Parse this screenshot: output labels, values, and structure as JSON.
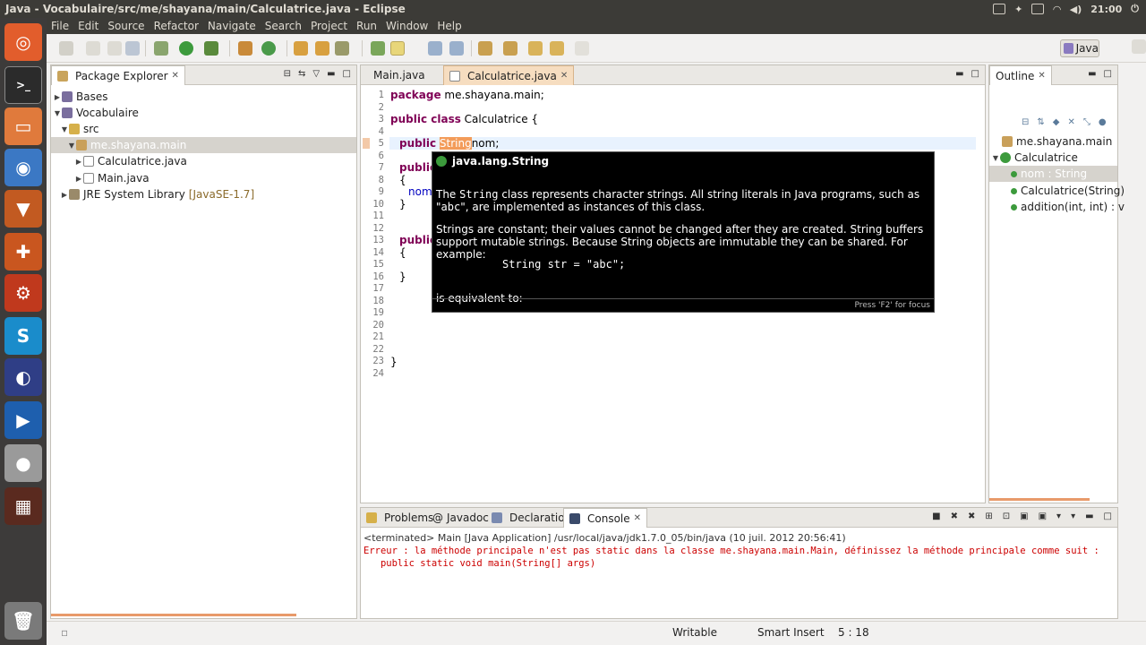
{
  "window": {
    "title": "Java - Vocabulaire/src/me/shayana/main/Calculatrice.java - Eclipse",
    "clock": "21:00"
  },
  "menu": [
    "File",
    "Edit",
    "Source",
    "Refactor",
    "Navigate",
    "Search",
    "Project",
    "Run",
    "Window",
    "Help"
  ],
  "toolbar": {
    "perspective_label": "Java"
  },
  "package_explorer": {
    "title": "Package Explorer",
    "items": [
      {
        "label": "Bases"
      },
      {
        "label": "Vocabulaire"
      },
      {
        "label": "src"
      },
      {
        "label": "me.shayana.main"
      },
      {
        "label": "Calculatrice.java"
      },
      {
        "label": "Main.java"
      },
      {
        "label": "JRE System Library",
        "suffix": "[JavaSE-1.7]"
      }
    ]
  },
  "editor": {
    "tabs": [
      "Main.java",
      "Calculatrice.java"
    ],
    "line_numbers": [
      "1",
      "2",
      "3",
      "4",
      "5",
      "6",
      "7",
      "8",
      "9",
      "10",
      "11",
      "12",
      "13",
      "14",
      "15",
      "16",
      "17",
      "18",
      "19",
      "20",
      "21",
      "22",
      "23",
      "24"
    ],
    "lines": {
      "l1_kw": "package",
      "l1_rest": " me.shayana.main;",
      "l3_kw": "public class",
      "l3_rest": " Calculatrice {",
      "l5_kw": "public",
      "l5_sel": "String",
      "l5_rest": "nom;",
      "l7": "public",
      "l8": "{",
      "l9": "nom",
      "l10": "}",
      "l13": "public",
      "l14": "{",
      "l16": "}",
      "l23": "}"
    }
  },
  "javadoc_hover": {
    "title": "java.lang.String",
    "p1a": "The ",
    "p1code": "String",
    "p1b": " class represents character strings. All string literals in Java programs, such as \"",
    "p1code2": "abc",
    "p1c": "\", are implemented as instances of this class.",
    "p2": "Strings are constant; their values cannot be changed after they are created. String buffers support mutable strings. Because String objects are immutable they can be shared. For example:",
    "example": "String str = \"abc\";",
    "p3": "is equivalent to:",
    "footer": "Press 'F2' for focus"
  },
  "outline": {
    "title": "Outline",
    "items": [
      {
        "label": "me.shayana.main"
      },
      {
        "label": "Calculatrice"
      },
      {
        "label": "nom : String"
      },
      {
        "label": "Calculatrice(String)"
      },
      {
        "label": "addition(int, int) : v"
      }
    ]
  },
  "console": {
    "tabs": [
      "Problems",
      "Javadoc",
      "Declaration",
      "Console"
    ],
    "header": "<terminated> Main [Java Application] /usr/local/java/jdk1.7.0_05/bin/java (10 juil. 2012 20:56:41)",
    "error1": "Erreur : la méthode principale n'est pas static dans la classe me.shayana.main.Main, définissez la méthode principale comme suit :",
    "error2": "   public static void main(String[] args)"
  },
  "status": {
    "mode": "Writable",
    "insert": "Smart Insert",
    "position": "5 : 18"
  },
  "colors": {
    "keyword": "#7f0055",
    "error": "#cc0000",
    "selection": "#f39c5a",
    "launcher": "#3d3b3a"
  }
}
